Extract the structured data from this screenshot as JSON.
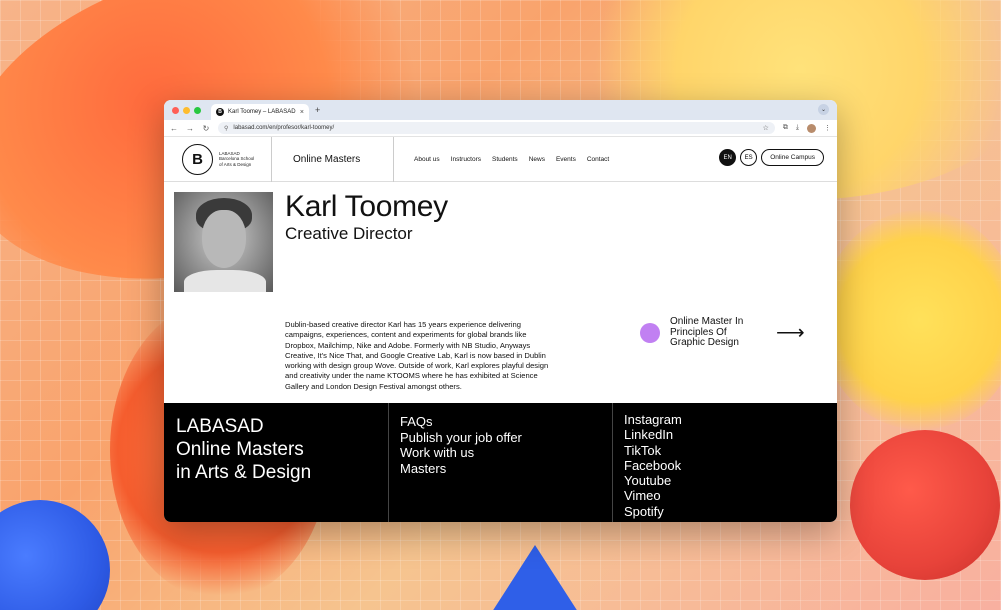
{
  "browser": {
    "tab_title": "Karl Toomey – LABASAD",
    "tab_favicon": "B",
    "url": "labasad.com/en/profesor/karl-toomey/",
    "traffic_colors": [
      "#ff5f57",
      "#febc2e",
      "#28c840"
    ]
  },
  "header": {
    "logo_letter": "B",
    "logo_lines": [
      "LABASAD",
      "Barcelona School",
      "of Arts & Design"
    ],
    "online_masters": "Online Masters",
    "nav": [
      "About us",
      "Instructors",
      "Students",
      "News",
      "Events",
      "Contact"
    ],
    "lang_en": "EN",
    "lang_es": "ES",
    "campus_button": "Online Campus"
  },
  "profile": {
    "name": "Karl Toomey",
    "role": "Creative Director",
    "bio_lines": [
      "Dublin-based creative director Karl has 15 years experience delivering",
      "campaigns, experiences, content and experiments for global brands like",
      "Dropbox, Mailchimp, Nike and Adobe. Formerly with NB Studio, Anyways",
      "Creative, It's Nice That, and Google Creative Lab, Karl is now based in Dublin",
      "working with design group Wove. Outside of work, Karl explores playful design",
      "and creativity under the name KTOOMS where he has exhibited at Science",
      "Gallery and London Design Festival amongst others."
    ],
    "program_lines": [
      "Online Master In",
      "Principles Of",
      "Graphic Design"
    ],
    "program_arrow": "⟶"
  },
  "footer": {
    "brand_lines": [
      "LABASAD",
      "Online Masters",
      "in Arts & Design"
    ],
    "links": [
      "FAQs",
      "Publish your job offer",
      "Work with us",
      "Masters"
    ],
    "social": [
      "Instagram",
      "LinkedIn",
      "TikTok",
      "Facebook",
      "Youtube",
      "Vimeo",
      "Spotify"
    ]
  },
  "colors": {
    "program_dot": "#c180f2",
    "footer_bg": "#000000"
  }
}
